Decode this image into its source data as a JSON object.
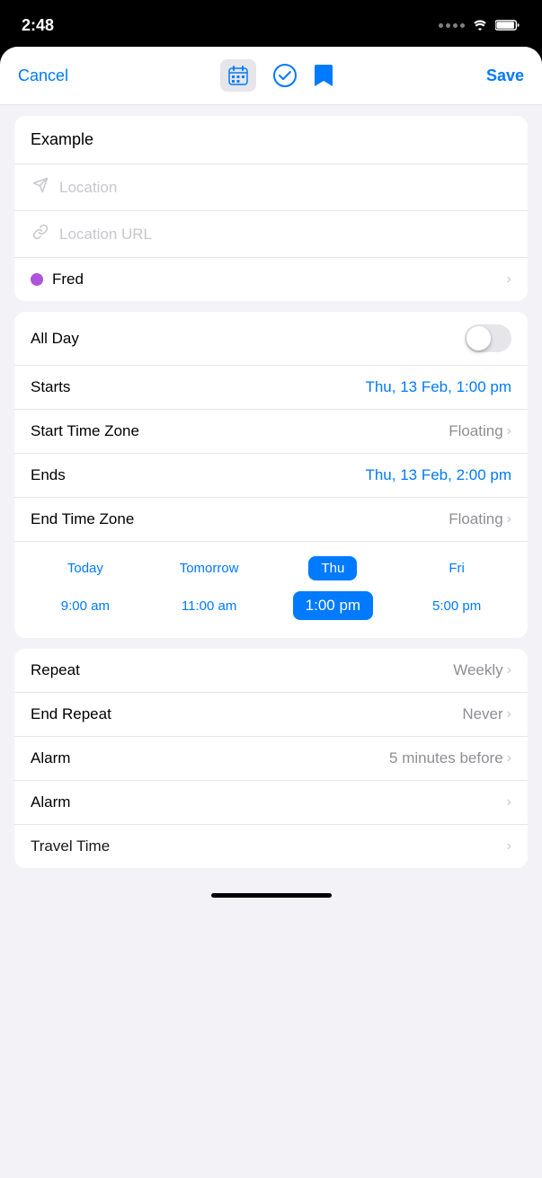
{
  "statusBar": {
    "time": "2:48"
  },
  "navBar": {
    "cancelLabel": "Cancel",
    "saveLabel": "Save"
  },
  "eventCard": {
    "titleValue": "Example",
    "locationPlaceholder": "Location",
    "locationUrlPlaceholder": "Location URL",
    "calendarName": "Fred"
  },
  "timeCard": {
    "allDayLabel": "All Day",
    "startsLabel": "Starts",
    "startsValue": "Thu, 13 Feb, 1:00 pm",
    "startTimeZoneLabel": "Start Time Zone",
    "startTimeZoneValue": "Floating",
    "endsLabel": "Ends",
    "endsValue": "Thu, 13 Feb, 2:00 pm",
    "endTimeZoneLabel": "End Time Zone",
    "endTimeZoneValue": "Floating",
    "days": [
      "Today",
      "Tomorrow",
      "Thu",
      "Fri"
    ],
    "times": [
      "9:00 am",
      "11:00 am",
      "1:00 pm",
      "5:00 pm"
    ],
    "selectedDayIndex": 2,
    "selectedTimeIndex": 2
  },
  "repeatCard": {
    "repeatLabel": "Repeat",
    "repeatValue": "Weekly",
    "endRepeatLabel": "End Repeat",
    "endRepeatValue": "Never",
    "alarm1Label": "Alarm",
    "alarm1Value": "5 minutes before",
    "alarm2Label": "Alarm",
    "alarm2Value": "",
    "travelTimeLabel": "Travel Time",
    "travelTimeValue": ""
  },
  "colors": {
    "blue": "#007AFF",
    "calendarDot": "#AF52DE",
    "placeholder": "#c7c7cc",
    "chevron": "#c7c7cc"
  }
}
